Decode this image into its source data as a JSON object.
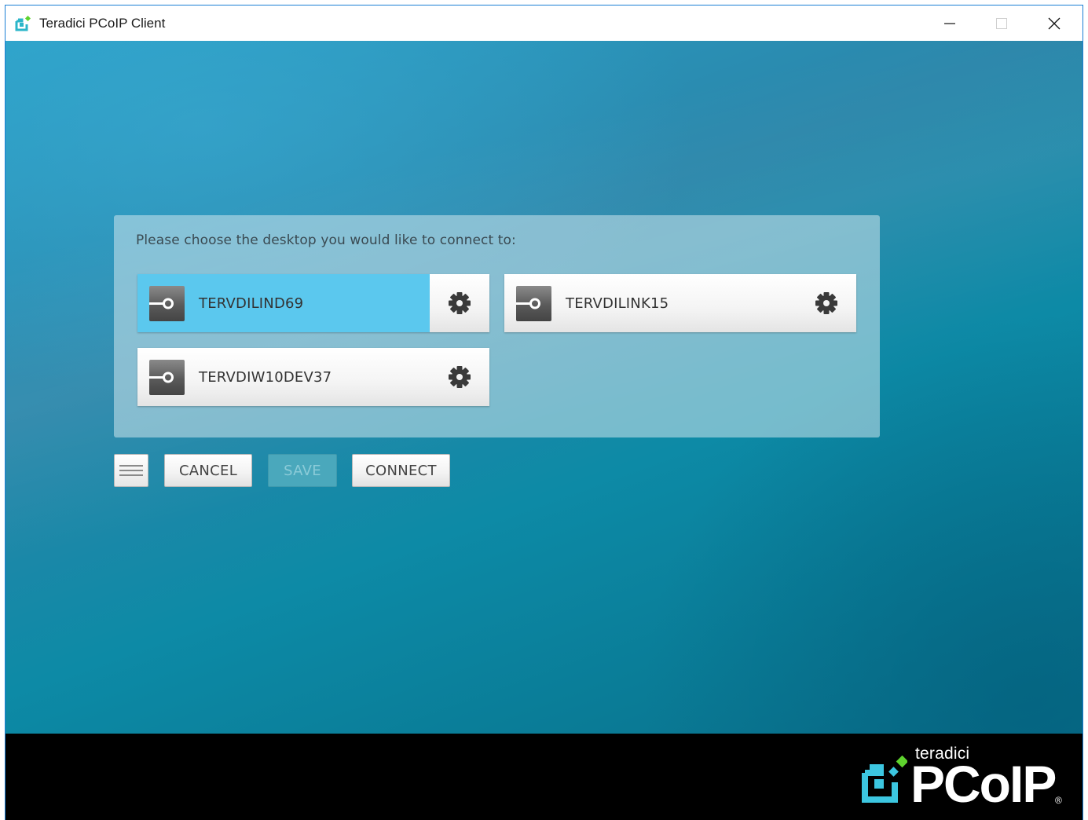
{
  "window": {
    "title": "Teradici PCoIP Client",
    "controls": [
      "minimize-icon",
      "maximize-icon",
      "close-icon"
    ]
  },
  "panel": {
    "prompt": "Please choose the desktop you would like to connect to:",
    "desktops": [
      {
        "name": "TERVDILIND69",
        "selected": true,
        "icon": "desktop-connection-icon",
        "settings_icon": "gear-icon"
      },
      {
        "name": "TERVDILINK15",
        "selected": false,
        "icon": "desktop-connection-icon",
        "settings_icon": "gear-icon"
      },
      {
        "name": "TERVDIW10DEV37",
        "selected": false,
        "icon": "desktop-connection-icon",
        "settings_icon": "gear-icon"
      }
    ]
  },
  "toolbar": {
    "menu_icon": "hamburger-menu-icon",
    "cancel_label": "CANCEL",
    "save_label": "SAVE",
    "save_enabled": false,
    "connect_label": "CONNECT"
  },
  "footer": {
    "brand": "teradici",
    "product": "PCoIP",
    "registered": "®"
  },
  "colors": {
    "selected_tile": "#5bc8ee",
    "background_teal": "#0d8aa6",
    "logo_green": "#5ed32e",
    "logo_cyan": "#3cc6e0"
  }
}
